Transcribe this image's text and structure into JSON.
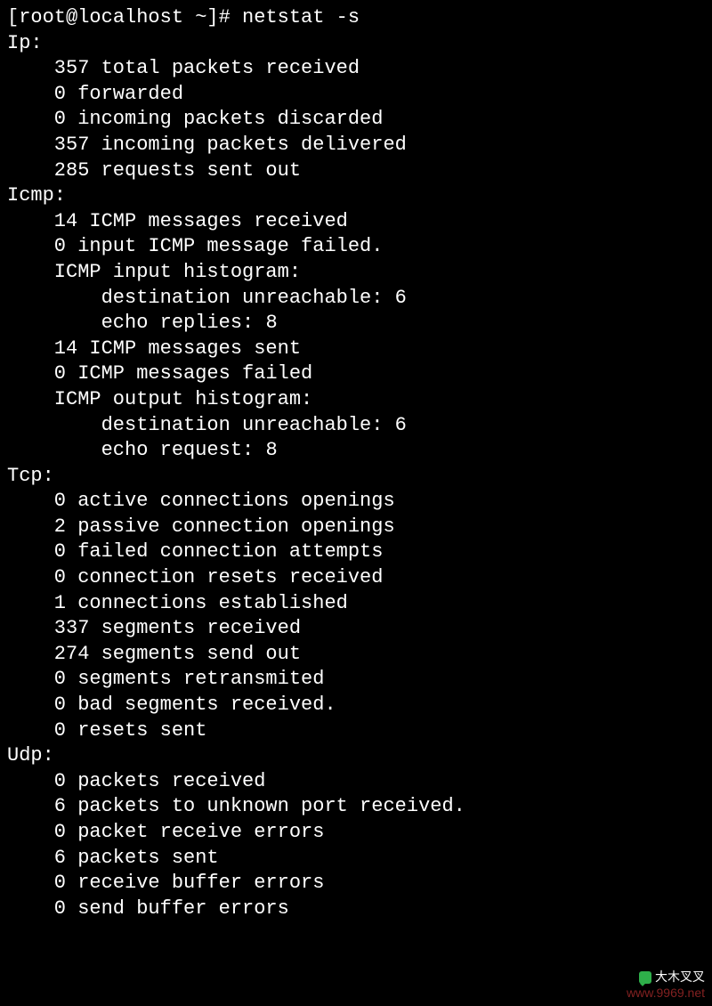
{
  "prompt": "[root@localhost ~]# netstat -s",
  "ip": {
    "header": "Ip:",
    "lines": {
      "total": "357 total packets received",
      "forwarded": "0 forwarded",
      "discarded": "0 incoming packets discarded",
      "delivered": "357 incoming packets delivered",
      "requests": "285 requests sent out"
    }
  },
  "icmp": {
    "header": "Icmp:",
    "received": "14 ICMP messages received",
    "failed_in": "0 input ICMP message failed.",
    "hist_in_title": "ICMP input histogram:",
    "hist_in_dest": "destination unreachable: 6",
    "hist_in_echo": "echo replies: 8",
    "sent": "14 ICMP messages sent",
    "failed_out": "0 ICMP messages failed",
    "hist_out_title": "ICMP output histogram:",
    "hist_out_dest": "destination unreachable: 6",
    "hist_out_echo": "echo request: 8"
  },
  "tcp": {
    "header": "Tcp:",
    "active": "0 active connections openings",
    "passive": "2 passive connection openings",
    "failed": "0 failed connection attempts",
    "resets_recv": "0 connection resets received",
    "established": "1 connections established",
    "seg_recv": "337 segments received",
    "seg_sent": "274 segments send out",
    "retrans": "0 segments retransmited",
    "bad": "0 bad segments received.",
    "resets_sent": "0 resets sent"
  },
  "udp": {
    "header": "Udp:",
    "recv": "0 packets received",
    "unknown": "6 packets to unknown port received.",
    "errors": "0 packet receive errors",
    "sent": "6 packets sent",
    "buf_recv": "0 receive buffer errors",
    "buf_send": "0 send buffer errors"
  },
  "watermark": "大木叉叉",
  "url": "www.9969.net"
}
